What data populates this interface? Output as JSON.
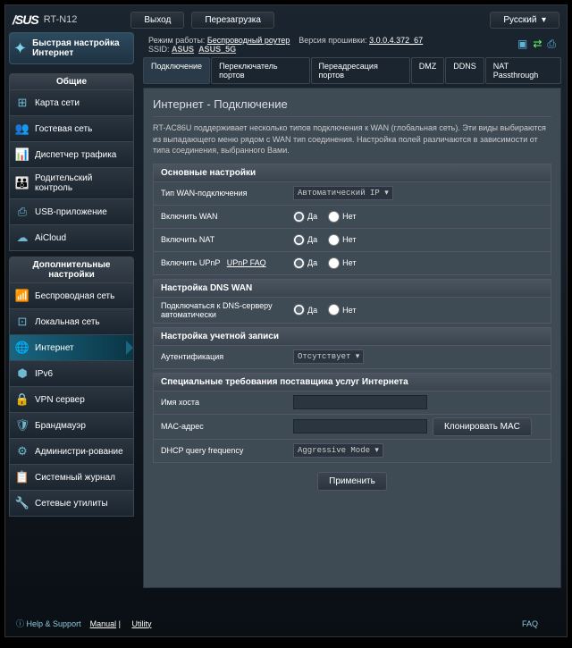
{
  "header": {
    "brand": "/SUS",
    "model": "RT-N12",
    "logout": "Выход",
    "reboot": "Перезагрузка",
    "language": "Русский"
  },
  "info": {
    "mode_label": "Режим работы:",
    "mode_value": "Беспроводный роутер",
    "fw_label": "Версия прошивки:",
    "fw_value": "3.0.0.4.372_67",
    "ssid_label": "SSID:",
    "ssid1": "ASUS",
    "ssid2": "ASUS_5G"
  },
  "quick": {
    "line1": "Быстрая настройка",
    "line2": "Интернет"
  },
  "sections": {
    "general": "Общие",
    "advanced": "Дополнительные настройки"
  },
  "nav_general": [
    {
      "label": "Карта сети",
      "icon": "⊞"
    },
    {
      "label": "Гостевая сеть",
      "icon": "👥"
    },
    {
      "label": "Диспетчер трафика",
      "icon": "📊"
    },
    {
      "label": "Родительский контроль",
      "icon": "👪"
    },
    {
      "label": "USB-приложение",
      "icon": "⎙"
    },
    {
      "label": "AiCloud",
      "icon": "☁"
    }
  ],
  "nav_adv": [
    {
      "label": "Беспроводная сеть",
      "icon": "📶"
    },
    {
      "label": "Локальная сеть",
      "icon": "⊡"
    },
    {
      "label": "Интернет",
      "icon": "🌐",
      "active": true
    },
    {
      "label": "IPv6",
      "icon": "⬢"
    },
    {
      "label": "VPN сервер",
      "icon": "🔒"
    },
    {
      "label": "Брандмауэр",
      "icon": "🛡"
    },
    {
      "label": "Администри-рование",
      "icon": "⚙"
    },
    {
      "label": "Системный журнал",
      "icon": "📋"
    },
    {
      "label": "Сетевые утилиты",
      "icon": "🔧"
    }
  ],
  "tabs": [
    "Подключение",
    "Переключатель портов",
    "Переадресация портов",
    "DMZ",
    "DDNS",
    "NAT Passthrough"
  ],
  "panel": {
    "title": "Интернет - Подключение",
    "desc": "RT-AC86U поддерживает несколько типов подключения к WAN (глобальная сеть). Эти виды выбираются из выпадающего меню рядом с WAN тип соединения. Настройка полей различаются в зависимости от типа соединения, выбранного Вами."
  },
  "groups": {
    "basic": "Основные настройки",
    "dns": "Настройка DNS WAN",
    "acct": "Настройка учетной записи",
    "isp": "Специальные требования поставщика услуг Интернета"
  },
  "fields": {
    "wan_type": "Тип WAN-подключения",
    "wan_type_val": "Автоматический IP ▾",
    "enable_wan": "Включить WAN",
    "enable_nat": "Включить NAT",
    "enable_upnp": "Включить UPnP",
    "upnp_faq": "UPnP FAQ",
    "dns_auto": "Подключаться к DNS-серверу автоматически",
    "auth": "Аутентификация",
    "auth_val": "Отсутствует ▾",
    "hostname": "Имя хоста",
    "mac": "MAC-адрес",
    "clone_mac": "Клонировать MAC",
    "dhcp_freq": "DHCP query frequency",
    "dhcp_freq_val": "Aggressive Mode ▾",
    "yes": "Да",
    "no": "Нет",
    "apply": "Применить"
  },
  "footer": {
    "help": "Help & Support",
    "manual": "Manual",
    "utility": "Utility",
    "faq": "FAQ"
  }
}
